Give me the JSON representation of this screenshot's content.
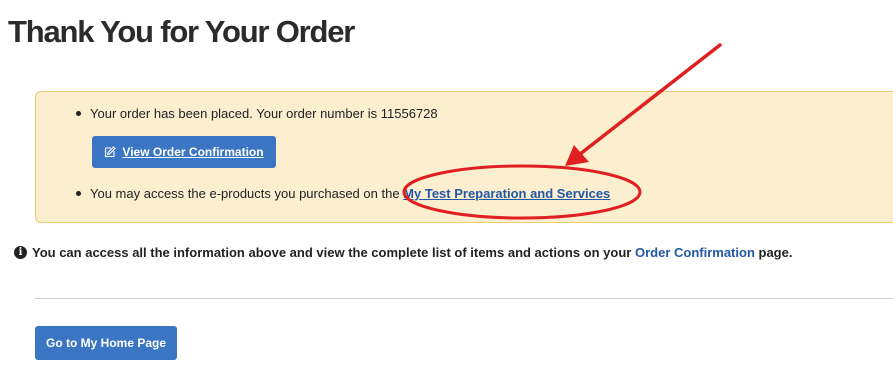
{
  "page": {
    "title": "Thank You for Your Order"
  },
  "notice": {
    "order_text": "Your order has been placed. Your order number is 11556728",
    "confirm_button_label": "View Order Confirmation",
    "eproducts_text": "You may access the e-products you purchased on the",
    "eproducts_link": "My Test Preparation and Services"
  },
  "info": {
    "text_before": "You can access all the information above and view the complete list of items and actions on your",
    "link": "Order Confirmation",
    "text_after": "page."
  },
  "actions": {
    "home_button_label": "Go to My Home Page"
  },
  "annotation": {
    "color": "#e02020"
  },
  "colors": {
    "button": "#3a76c4",
    "link": "#2257a8",
    "notice_bg": "#fcefcf",
    "notice_border": "#efc978"
  }
}
